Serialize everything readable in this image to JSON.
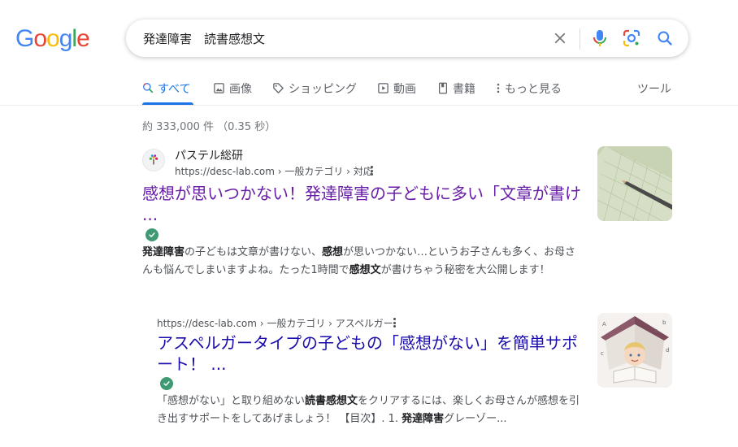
{
  "logo": {
    "letters": [
      "G",
      "o",
      "o",
      "g",
      "l",
      "e"
    ],
    "colors": [
      "#4285F4",
      "#EA4335",
      "#FBBC05",
      "#4285F4",
      "#34A853",
      "#EA4335"
    ]
  },
  "search": {
    "query": "発達障害　読書感想文"
  },
  "tabs": [
    {
      "label": "すべて",
      "icon": "search-icon",
      "active": true
    },
    {
      "label": "画像",
      "icon": "image-icon"
    },
    {
      "label": "ショッピング",
      "icon": "tag-icon"
    },
    {
      "label": "動画",
      "icon": "play-icon"
    },
    {
      "label": "書籍",
      "icon": "book-icon"
    },
    {
      "label": "もっと見る",
      "icon": "more-vert-icon"
    }
  ],
  "tools_label": "ツール",
  "stats": "約 333,000 件 （0.35 秒）",
  "results": [
    {
      "site_name": "パステル総研",
      "cite": "https://desc-lab.com › 一般カテゴリ › 対応",
      "title_line1": "感想が思いつかない！発達障害の子どもに多い「文章が書け",
      "title_line2": "...",
      "snippet": [
        {
          "t": "発達障害",
          "b": true
        },
        {
          "t": "の子どもは文章が書けない、"
        },
        {
          "t": "感想",
          "b": true
        },
        {
          "t": "が思いつかない…というお子さんも多く、お母さんも悩んでしまいますよね。たった1時間で"
        },
        {
          "t": "感想文",
          "b": true
        },
        {
          "t": "が書けちゃう秘密を大公開します！"
        }
      ]
    },
    {
      "cite": "https://desc-lab.com › 一般カテゴリ › アスペルガー",
      "title_line1": "アスペルガータイプの子どもの「感想がない」を簡単サポ",
      "title_line2": "ート！ ...",
      "snippet": [
        {
          "t": "「感想がない」と取り組めない"
        },
        {
          "t": "読書感想文",
          "b": true
        },
        {
          "t": "をクリアするには、楽しくお母さんが感想を引き出すサポートをしてあげましょう！ 【目次】. 1. "
        },
        {
          "t": "発達障害",
          "b": true
        },
        {
          "t": "グレーゾー..."
        }
      ]
    }
  ]
}
